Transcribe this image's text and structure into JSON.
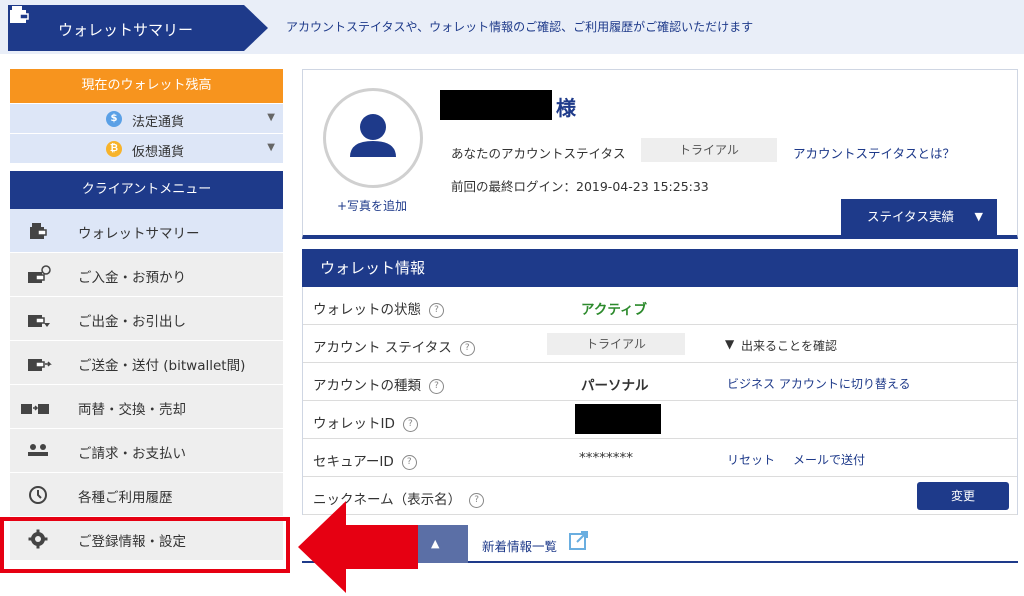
{
  "header": {
    "title": "ウォレットサマリー",
    "description": "アカウントステイタスや、ウォレット情報のご確認、ご利用履歴がご確認いただけます"
  },
  "sidebar": {
    "balance_heading": "現在のウォレット残高",
    "balances": [
      {
        "label": "法定通貨",
        "symbol": "$",
        "color": "#5aa0e6"
      },
      {
        "label": "仮想通貨",
        "symbol": "₿",
        "color": "#f7b32b"
      }
    ],
    "menu_heading": "クライアントメニュー",
    "items": [
      {
        "label": "ウォレットサマリー",
        "icon": "wallet-icon"
      },
      {
        "label": "ご入金・お預かり",
        "icon": "wallet-deposit-icon"
      },
      {
        "label": "ご出金・お引出し",
        "icon": "wallet-withdraw-icon"
      },
      {
        "label": "ご送金・送付 (bitwallet間)",
        "icon": "wallet-transfer-icon"
      },
      {
        "label": "両替・交換・売却",
        "icon": "exchange-icon"
      },
      {
        "label": "ご請求・お支払い",
        "icon": "users-icon"
      },
      {
        "label": "各種ご利用履歴",
        "icon": "history-icon"
      },
      {
        "label": "ご登録情報・設定",
        "icon": "gear-icon"
      }
    ]
  },
  "profile": {
    "honorific": "様",
    "add_photo": "+写真を追加",
    "status_label": "あなたのアカウントステイタス",
    "status_value": "トライアル",
    "status_link": "アカウントステイタスとは？",
    "last_login": "前回の最終ログイン：2019-04-23 15:25:33",
    "status_tab": "ステイタス実績"
  },
  "wallet": {
    "heading": "ウォレット情報",
    "rows": {
      "state": {
        "key": "ウォレットの状態",
        "value": "アクティブ"
      },
      "status": {
        "key": "アカウント ステイタス",
        "value": "トライアル",
        "link": "出来ることを確認"
      },
      "type": {
        "key": "アカウントの種類",
        "value": "パーソナル",
        "link": "ビジネス アカウントに切り替える"
      },
      "wallet_id": {
        "key": "ウォレットID"
      },
      "secure_id": {
        "key": "セキュアーID",
        "value": "********",
        "reset": "リセット",
        "mail": "メールで送付"
      },
      "nickname": {
        "key": "ニックネーム（表示名）",
        "button": "変更"
      }
    }
  },
  "news": {
    "link": "新着情報一覧"
  },
  "colors": {
    "navy": "#1e3a8a",
    "orange": "#f7941e",
    "highlight_red": "#e60012",
    "active_green": "#2c8a2c"
  }
}
